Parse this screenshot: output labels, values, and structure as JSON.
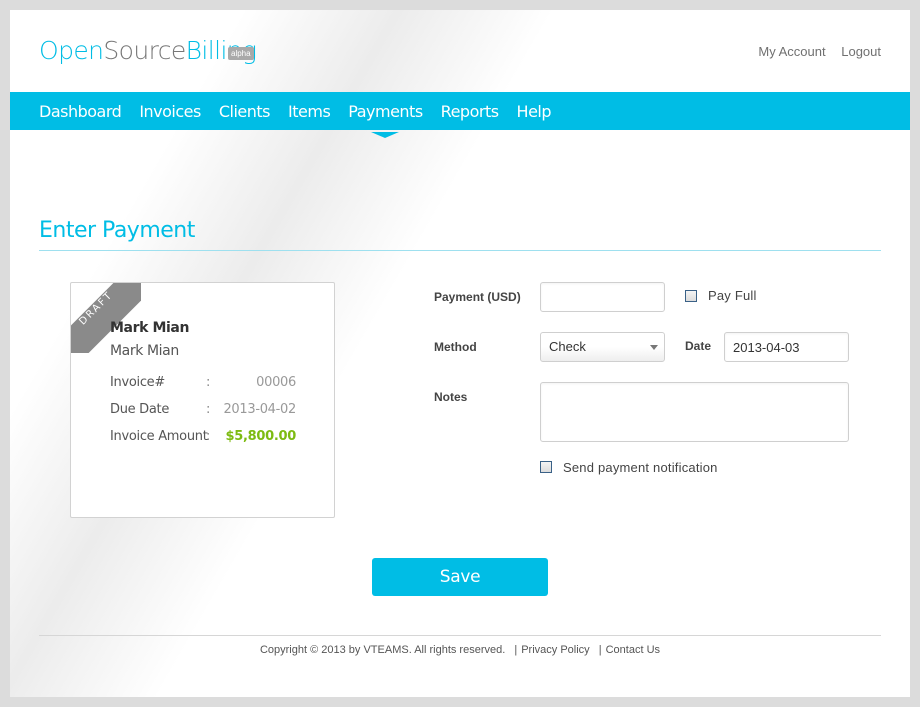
{
  "brand": {
    "name_part1": "Open",
    "name_part2": "Source",
    "name_part3": "Billing",
    "badge": "alpha"
  },
  "top_links": {
    "account": "My Account",
    "logout": "Logout"
  },
  "nav": {
    "items": [
      {
        "label": "Dashboard",
        "active": false
      },
      {
        "label": "Invoices",
        "active": false
      },
      {
        "label": "Clients",
        "active": false
      },
      {
        "label": "Items",
        "active": false
      },
      {
        "label": "Payments",
        "active": true
      },
      {
        "label": "Reports",
        "active": false
      },
      {
        "label": "Help",
        "active": false
      }
    ]
  },
  "page": {
    "title": "Enter Payment"
  },
  "invoice_card": {
    "status_ribbon": "DRAFT",
    "client_name": "Mark Mian",
    "client_company": "Mark Mian",
    "rows": [
      {
        "label": "Invoice#",
        "colon": ":",
        "value": "00006"
      },
      {
        "label": "Due Date",
        "colon": ":",
        "value": "2013-04-02"
      },
      {
        "label": "Invoice Amount",
        "colon": ":",
        "value": "$5,800.00"
      }
    ]
  },
  "form": {
    "payment_label": "Payment (USD)",
    "payment_value": "",
    "pay_full_label": "Pay Full",
    "pay_full_checked": false,
    "method_label": "Method",
    "method_value": "Check",
    "date_label": "Date",
    "date_value": "2013-04-03",
    "notes_label": "Notes",
    "notes_value": "",
    "send_notification_label": "Send payment notification",
    "send_notification_checked": false
  },
  "actions": {
    "save_label": "Save"
  },
  "footer": {
    "copyright": "Copyright © 2013 by VTEAMS. All rights reserved.",
    "privacy": "Privacy Policy",
    "contact": "Contact Us",
    "separator": "|"
  },
  "colors": {
    "accent": "#00bde5",
    "amount_green": "#7dbb12",
    "ribbon_gray": "#8a8a8a"
  }
}
